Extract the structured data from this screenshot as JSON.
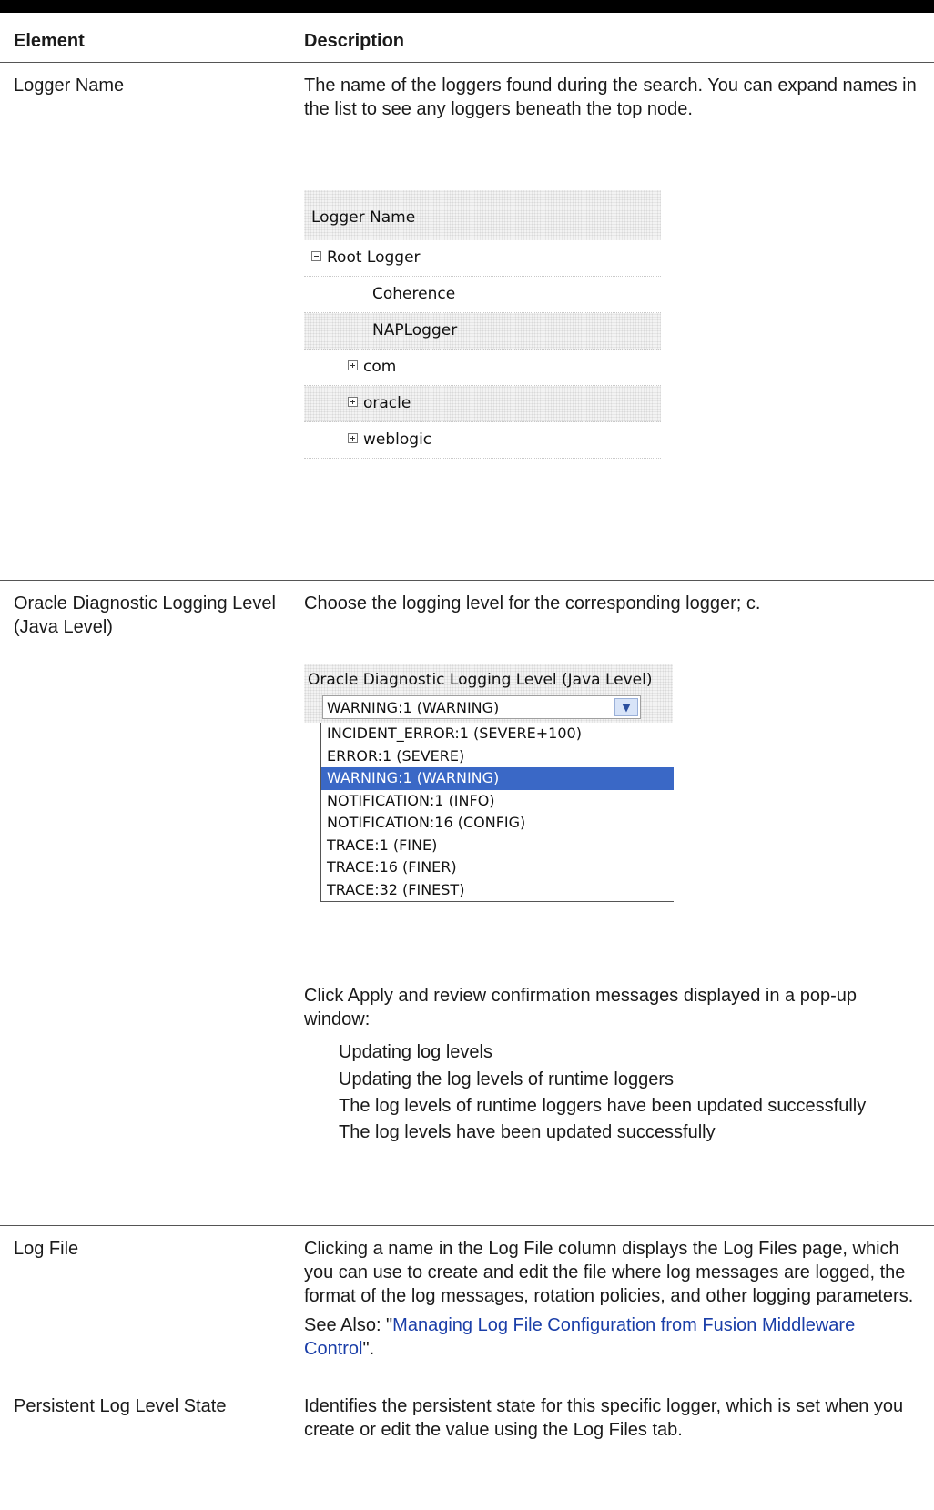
{
  "table": {
    "header": {
      "col1": "Element",
      "col2": "Description"
    },
    "rows": {
      "logger_name": {
        "element": "Logger Name",
        "description": "The name of the loggers found during the search. You can expand names in the list to see any loggers beneath the top node.",
        "figure": {
          "header": "Logger Name",
          "items": [
            {
              "label": "Root Logger",
              "toggle": "minus"
            },
            {
              "label": "Coherence",
              "toggle": ""
            },
            {
              "label": "NAPLogger",
              "toggle": ""
            },
            {
              "label": "com",
              "toggle": "plus"
            },
            {
              "label": "oracle",
              "toggle": "plus"
            },
            {
              "label": "weblogic",
              "toggle": "plus"
            }
          ]
        }
      },
      "odl_level": {
        "element": "Oracle Diagnostic Logging Level (Java Level)",
        "description": "Choose the logging level for the corresponding logger; c.",
        "figure": {
          "header": "Oracle Diagnostic Logging Level (Java Level)",
          "selected": "WARNING:1 (WARNING)",
          "options": [
            "INCIDENT_ERROR:1 (SEVERE+100)",
            "ERROR:1 (SEVERE)",
            "WARNING:1 (WARNING)",
            "NOTIFICATION:1 (INFO)",
            "NOTIFICATION:16 (CONFIG)",
            "TRACE:1 (FINE)",
            "TRACE:16 (FINER)",
            "TRACE:32 (FINEST)"
          ],
          "highlighted_option": "WARNING:1 (WARNING)"
        },
        "apply_note": "Click Apply and review confirmation messages displayed in a pop-up window:",
        "messages": [
          "Updating log levels",
          "Updating the log levels of runtime loggers",
          "The log levels of runtime loggers have been updated successfully",
          "The log levels have been updated successfully"
        ]
      },
      "log_file": {
        "element": "Log File",
        "description": "Clicking a name in the Log File column displays the Log Files page, which you can use to create and edit the file where log messages are logged, the format of the log messages, rotation policies, and other logging parameters.",
        "see_also_prefix": "See Also: \"",
        "see_also_link": "Managing Log File Configuration from Fusion Middleware Control",
        "see_also_suffix": "\"."
      },
      "persistent_state": {
        "element": "Persistent Log Level State",
        "description": "Identifies the persistent state for this specific logger, which is set when you create or edit the value using the Log Files tab."
      }
    }
  },
  "colors": {
    "link": "#1a3ea8",
    "selection": "#3a68c6",
    "rule": "#555555"
  }
}
